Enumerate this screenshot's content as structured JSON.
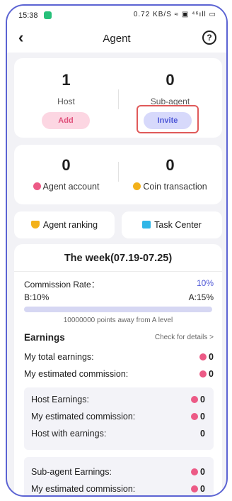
{
  "status_bar": {
    "time": "15:38",
    "right": "0.72 KB/S ≈ ▣ ⁴⁶ıll ▭"
  },
  "header": {
    "back_icon": "‹",
    "title": "Agent",
    "help_icon": "?"
  },
  "host_card": {
    "host_count": "1",
    "host_label": "Host",
    "add_label": "Add",
    "subagent_count": "0",
    "subagent_label": "Sub-agent",
    "invite_label": "Invite"
  },
  "account_card": {
    "agent_account_value": "0",
    "agent_account_label": "Agent account",
    "coin_transaction_value": "0",
    "coin_transaction_label": "Coin transaction"
  },
  "links": {
    "agent_ranking": "Agent ranking",
    "task_center": "Task Center"
  },
  "commission": {
    "week_title": "The week(07.19-07.25)",
    "rate_label": "Commission Rate：",
    "rate_value": "10%",
    "b_level": "B:10%",
    "a_level": "A:15%",
    "progress": 0,
    "points_away": "10000000 points away from A level"
  },
  "earnings": {
    "title": "Earnings",
    "check_details": "Check for details >",
    "total_label": "My total earnings:",
    "total_value": "0",
    "estimated_label": "My estimated commission:",
    "estimated_value": "0",
    "host_section": {
      "host_earnings_label": "Host Earnings:",
      "host_earnings_value": "0",
      "estimated_label": "My estimated commission:",
      "estimated_value": "0",
      "with_earnings_label": "Host with earnings:",
      "with_earnings_value": "0"
    },
    "subagent_section": {
      "subagent_earnings_label": "Sub-agent Earnings:",
      "subagent_earnings_value": "0",
      "estimated_label": "My estimated commission:",
      "estimated_value": "0"
    }
  },
  "colors": {
    "accent": "#4c55d6",
    "pink": "#ec5a86",
    "gold": "#f3b11a",
    "frame": "#5b63d3"
  }
}
